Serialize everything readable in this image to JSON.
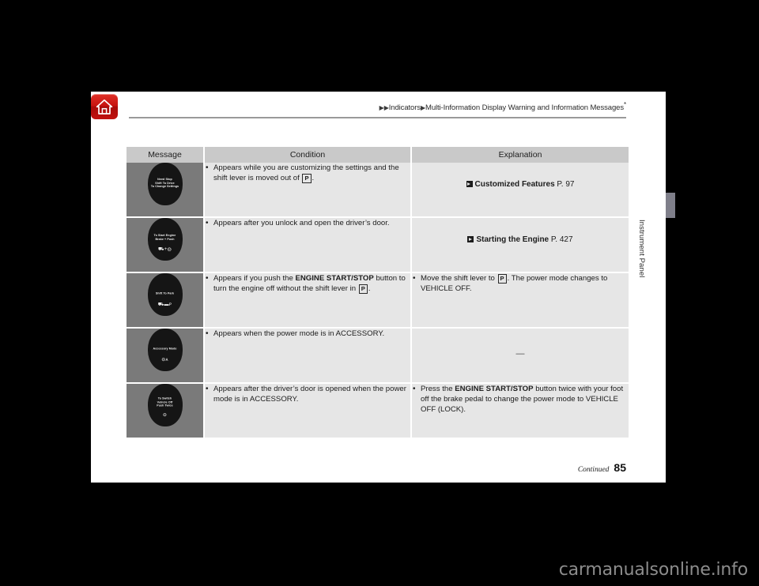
{
  "header": {
    "home_icon": "home-icon",
    "breadcrumb_prefix": "▶▶",
    "breadcrumb_sep": "▶",
    "breadcrumb_parent": "Indicators",
    "breadcrumb_current": "Multi-Information Display Warning and Information Messages",
    "breadcrumb_footnote": "*"
  },
  "table": {
    "columns": [
      "Message",
      "Condition",
      "Explanation"
    ],
    "rows": [
      {
        "message_display": "Need Stop\nShift To Drive\nTo Change Settings",
        "message_icons": "",
        "condition_pre": "Appears while you are customizing the settings and the shift lever is moved out of ",
        "condition_box": "P",
        "condition_post": ".",
        "explanation_type": "reference",
        "reference_title": "Customized Features",
        "reference_page": "P. 97"
      },
      {
        "message_display": "To Start Engine\nBrake + Push",
        "message_icons": "⛟+⊖",
        "condition_pre": "Appears after you unlock and open the driver’s door.",
        "condition_box": "",
        "condition_post": "",
        "explanation_type": "reference",
        "reference_title": "Starting the Engine",
        "reference_page": "P. 427"
      },
      {
        "message_display": "Shift To Park",
        "message_icons": "⛟▬ᴘ",
        "condition_pre": "Appears if you push the ",
        "condition_bold": "ENGINE START/STOP",
        "condition_mid": " button to turn the engine off without the shift lever in ",
        "condition_box": "P",
        "condition_post": ".",
        "explanation_type": "bullet",
        "explanation_pre": "Move the shift lever to ",
        "explanation_box": "P",
        "explanation_post": ". The power mode changes to VEHICLE OFF."
      },
      {
        "message_display": "Accessory Mode",
        "message_icons": "⊖ᴀ",
        "condition_pre": "Appears when the power mode is in ACCESSORY.",
        "condition_box": "",
        "condition_post": "",
        "explanation_type": "dash",
        "dash": "—"
      },
      {
        "message_display": "To Switch\nVehicle Off\nPush Twice",
        "message_icons": "⊖",
        "condition_pre": "Appears after the driver’s door is opened when the power mode is in ACCESSORY.",
        "condition_box": "",
        "condition_post": "",
        "explanation_type": "bullet-bold",
        "explanation_pre": "Press the ",
        "explanation_bold": "ENGINE START/STOP",
        "explanation_post": " button twice with your foot off the brake pedal to change the power mode to VEHICLE OFF (LOCK)."
      }
    ]
  },
  "footer": {
    "continued": "Continued",
    "page_number": "85"
  },
  "side": {
    "section_label": "Instrument Panel"
  },
  "watermark": {
    "text": "carmanualsonline.info"
  }
}
